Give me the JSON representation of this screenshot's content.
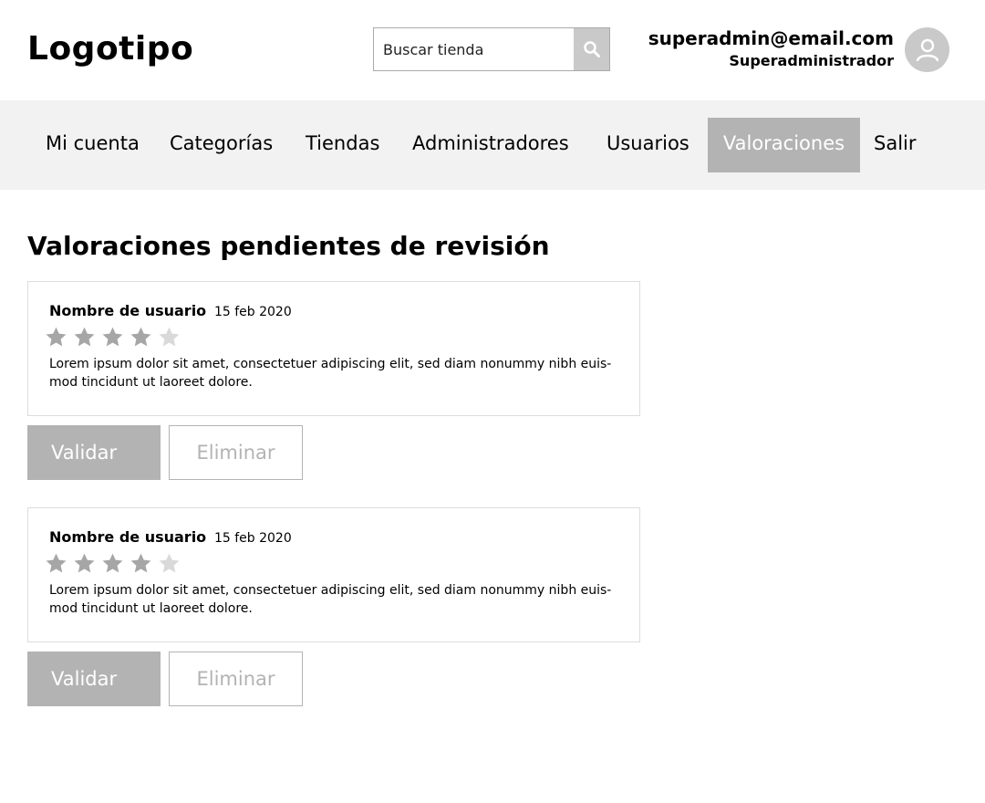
{
  "header": {
    "logo": "Logotipo",
    "search": {
      "placeholder": "Buscar tienda",
      "button_icon": "search-icon"
    },
    "user": {
      "email": "superadmin@email.com",
      "role": "Superadministrador",
      "avatar_icon": "user-icon"
    }
  },
  "nav": {
    "items": [
      {
        "label": "Mi cuenta",
        "active": false
      },
      {
        "label": "Categorías",
        "active": false
      },
      {
        "label": "Tiendas",
        "active": false
      },
      {
        "label": "Administradores",
        "active": false
      },
      {
        "label": "Usuarios",
        "active": false
      },
      {
        "label": "Valoraciones",
        "active": true
      },
      {
        "label": "Salir",
        "active": false
      }
    ]
  },
  "page": {
    "title": "Valoraciones pendientes de revisión"
  },
  "reviews": [
    {
      "username": "Nombre de usuario",
      "date": "15 feb 2020",
      "rating": 4,
      "max_rating": 5,
      "text": "Lorem ipsum dolor sit amet, consectetuer adipiscing elit, sed diam nonummy nibh euis-mod tincidunt ut laoreet dolore.",
      "validate_label": "Validar",
      "delete_label": "Eliminar"
    },
    {
      "username": "Nombre de usuario",
      "date": "15 feb 2020",
      "rating": 4,
      "max_rating": 5,
      "text": "Lorem ipsum dolor sit amet, consectetuer adipiscing elit, sed diam nonummy nibh euis-mod tincidunt ut laoreet dolore.",
      "validate_label": "Validar",
      "delete_label": "Eliminar"
    }
  ],
  "colors": {
    "accent_gray": "#b3b3b3",
    "nav_background": "#f2f2f2",
    "star_filled": "#a6a6a6",
    "star_empty": "#d9d9d9"
  }
}
